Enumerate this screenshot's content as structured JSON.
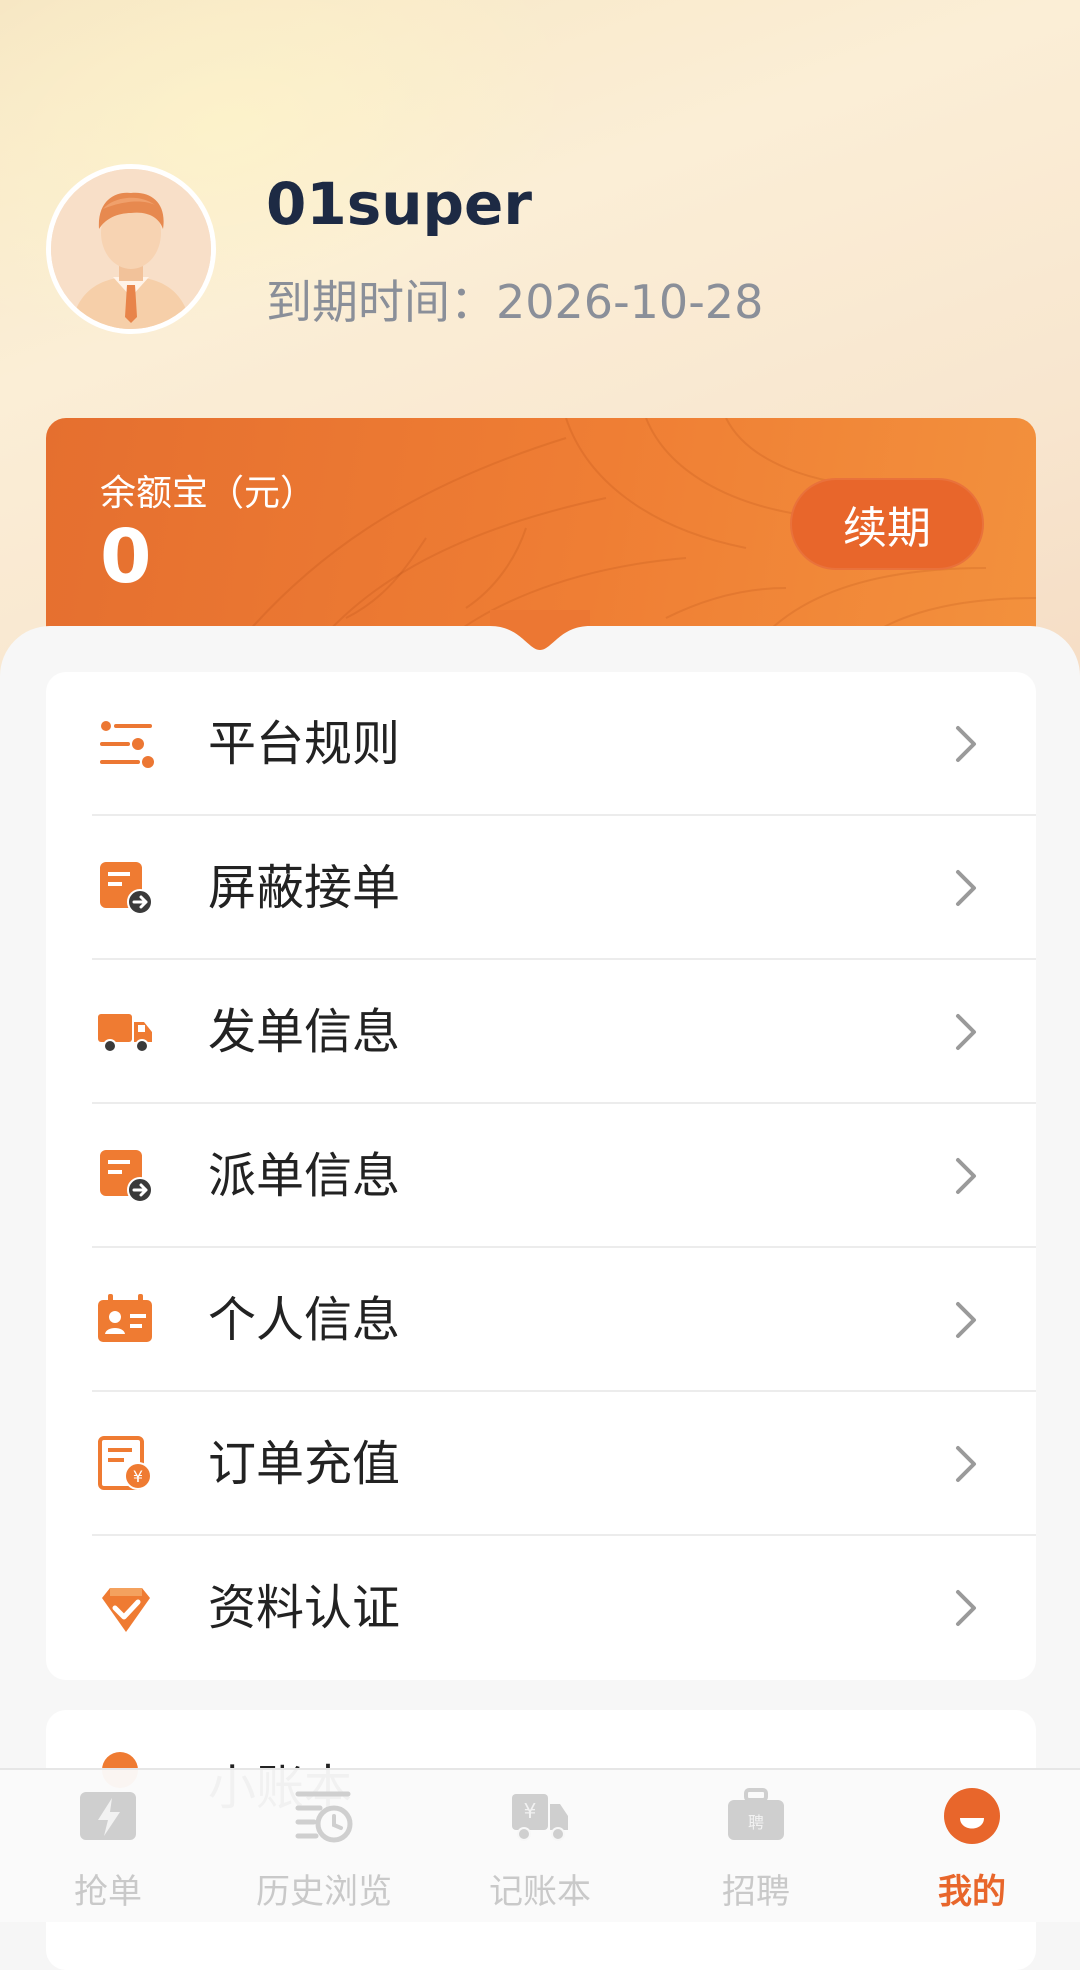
{
  "profile": {
    "username": "01super",
    "expire_label": "到期时间：",
    "expire_date": "2026-10-28"
  },
  "balance": {
    "label": "余额宝（元）",
    "value": "0",
    "renew_button": "续期"
  },
  "menu": {
    "items": [
      {
        "label": "平台规则",
        "icon": "sliders-icon"
      },
      {
        "label": "屏蔽接单",
        "icon": "block-order-icon"
      },
      {
        "label": "发单信息",
        "icon": "truck-icon"
      },
      {
        "label": "派单信息",
        "icon": "dispatch-icon"
      },
      {
        "label": "个人信息",
        "icon": "id-card-icon"
      },
      {
        "label": "订单充值",
        "icon": "recharge-icon"
      },
      {
        "label": "资料认证",
        "icon": "verified-badge-icon"
      }
    ],
    "partial_next_label": "小账本"
  },
  "tabbar": {
    "tabs": [
      {
        "label": "抢单",
        "icon": "lightning-card-icon",
        "active": false
      },
      {
        "label": "历史浏览",
        "icon": "history-list-icon",
        "active": false
      },
      {
        "label": "记账本",
        "icon": "ledger-truck-icon",
        "active": false
      },
      {
        "label": "招聘",
        "icon": "briefcase-icon",
        "active": false
      },
      {
        "label": "我的",
        "icon": "profile-face-icon",
        "active": true
      }
    ]
  },
  "colors": {
    "accent": "#e8662b",
    "accent_light": "#f3913d",
    "text_dark": "#222222",
    "muted": "#c9c9c9"
  }
}
